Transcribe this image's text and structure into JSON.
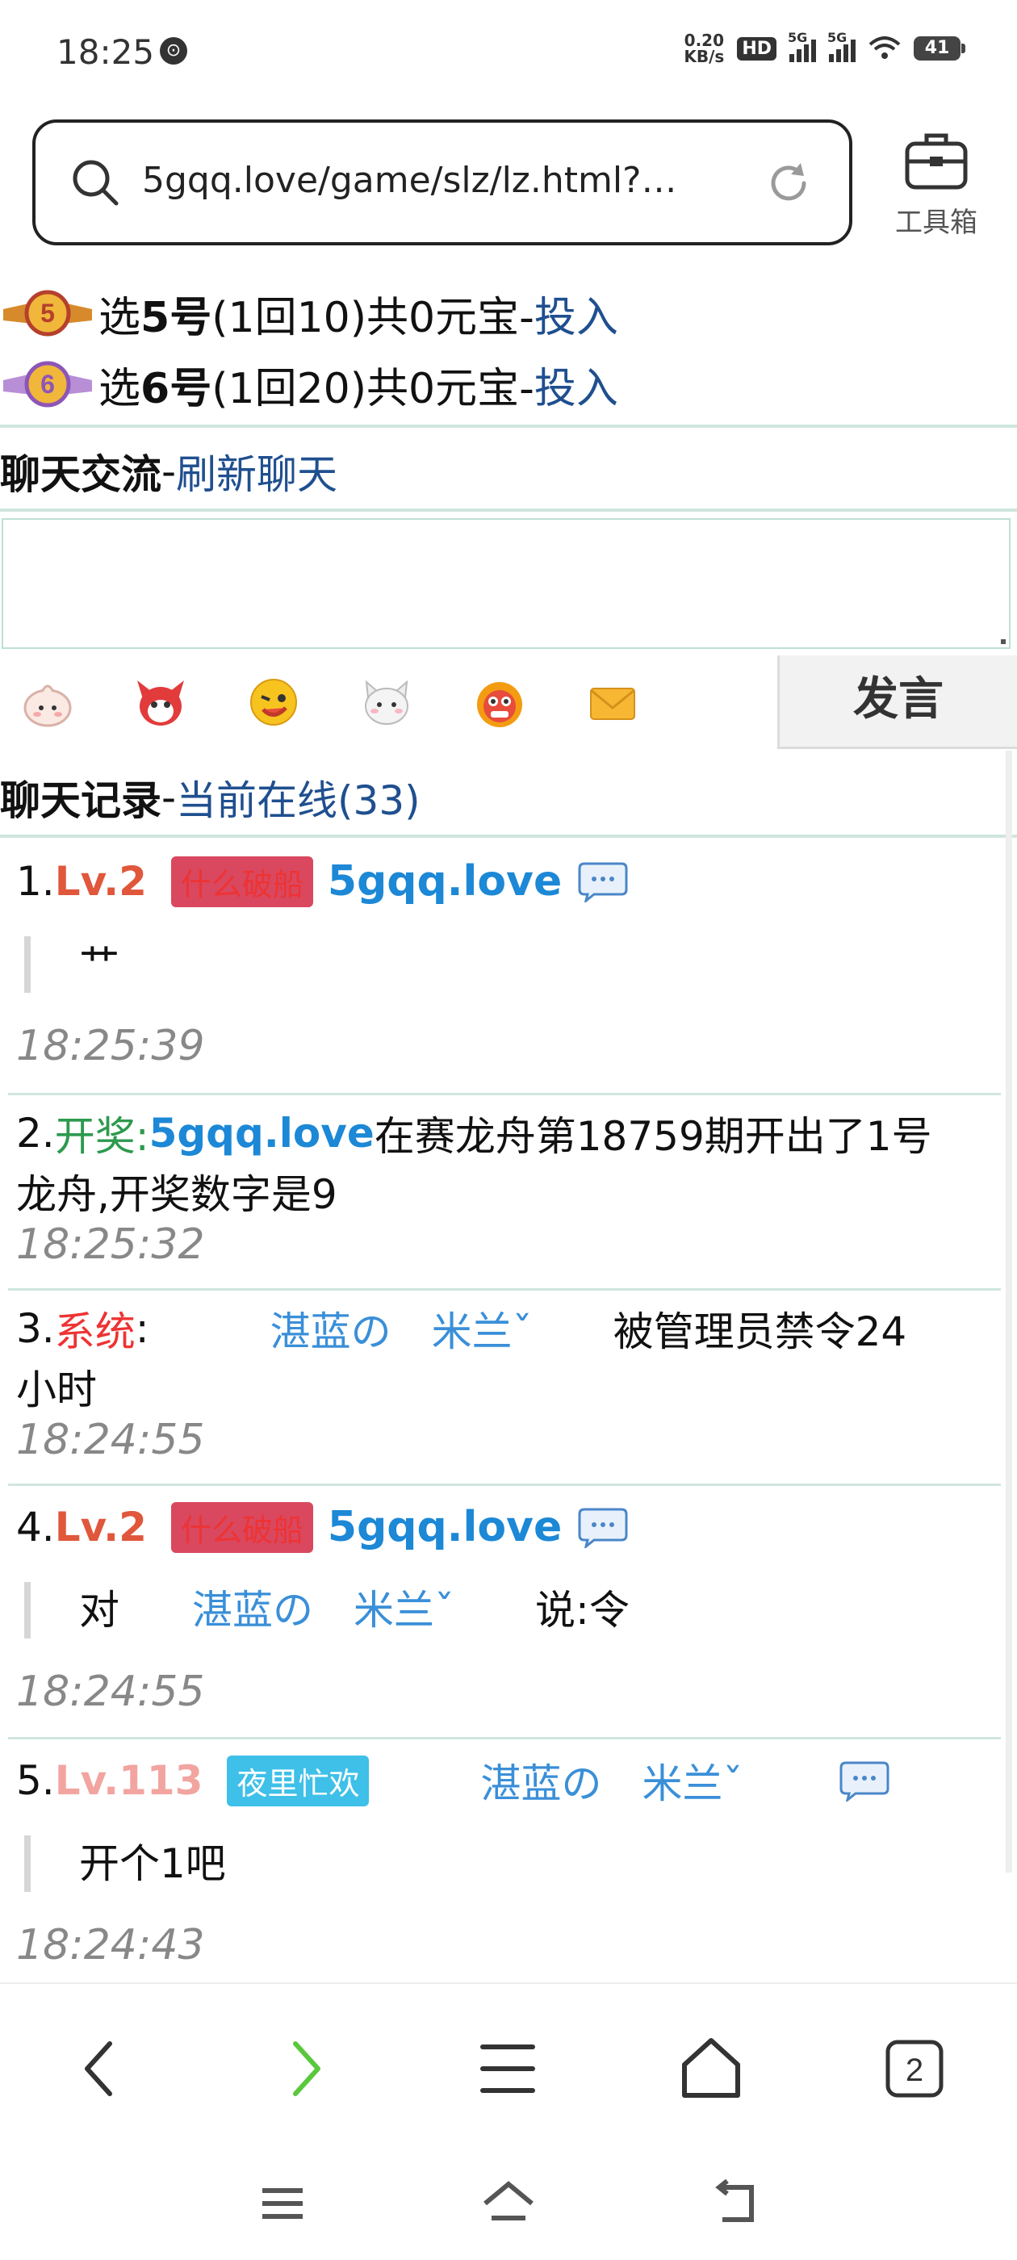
{
  "status_bar": {
    "time": "18:25",
    "speed_top": "0.20",
    "speed_bottom": "KB/s",
    "hd_badge": "HD",
    "net1": "5G",
    "net2": "5G",
    "battery": "41"
  },
  "browser": {
    "url": "5gqq.love/game/slz/lz.html?…",
    "toolbox_label": "工具箱"
  },
  "bets": [
    {
      "pre": "选",
      "num": "5号",
      "detail": "(1回10)共0元宝-",
      "link": "投入",
      "badge": "5"
    },
    {
      "pre": "选",
      "num": "6号",
      "detail": "(1回20)共0元宝-",
      "link": "投入",
      "badge": "6"
    }
  ],
  "chat": {
    "heading": "聊天交流",
    "dash": "-",
    "refresh_link": "刷新聊天",
    "send_button": "发言",
    "records_heading": "聊天记录",
    "online_link": "当前在线(33)"
  },
  "messages": [
    {
      "idx": "1.",
      "level": "Lv.2",
      "tag": "什么破船",
      "user": "5gqq.love",
      "text": "艹",
      "time": "18:25:39"
    },
    {
      "idx": "2.",
      "prefix": "开奖:",
      "user": "5gqq.love",
      "text1": "在赛龙舟第18759期开出了1号",
      "text2": "龙舟,开奖数字是9",
      "time": "18:25:32"
    },
    {
      "idx": "3.",
      "prefix": "系统",
      "colon": ":",
      "user": "湛蓝の　米兰ˇ",
      "text1": "被管理员禁令24",
      "text2": "小时",
      "time": "18:24:55"
    },
    {
      "idx": "4.",
      "level": "Lv.2",
      "tag": "什么破船",
      "user": "5gqq.love",
      "to_pre": "对",
      "to_user": "湛蓝の　米兰ˇ",
      "to_text": "说:令",
      "time": "18:24:55"
    },
    {
      "idx": "5.",
      "level": "Lv.113",
      "tag": "夜里忙欢",
      "user": "湛蓝の　米兰ˇ",
      "text": "开个1吧",
      "time": "18:24:43"
    }
  ],
  "tabs_count": "2",
  "icons": [
    "search-icon",
    "reload-icon",
    "toolbox-icon",
    "chat-bubble-icon",
    "back-icon",
    "forward-icon",
    "menu-icon",
    "home-icon",
    "tabs-icon"
  ]
}
